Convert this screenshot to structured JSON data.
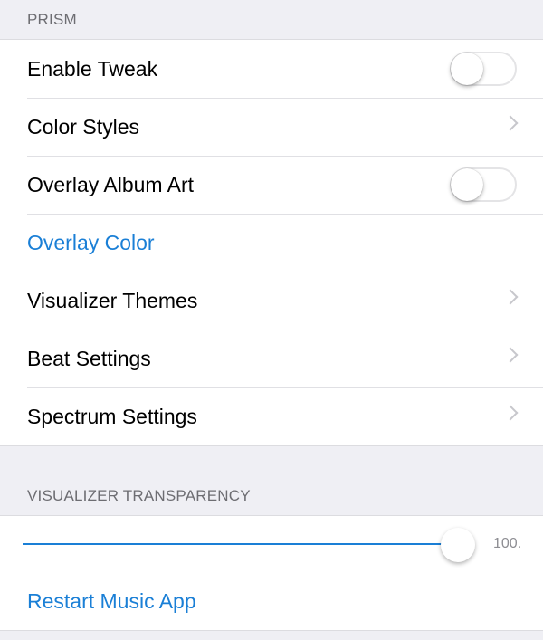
{
  "sections": [
    {
      "header": "PRISM",
      "rows": [
        {
          "label": "Enable Tweak",
          "accessory": "toggle",
          "on": false
        },
        {
          "label": "Color Styles",
          "accessory": "chevron"
        },
        {
          "label": "Overlay Album Art",
          "accessory": "toggle",
          "on": false
        },
        {
          "label": "Overlay Color",
          "accessory": "none",
          "style": "link"
        },
        {
          "label": "Visualizer Themes",
          "accessory": "chevron"
        },
        {
          "label": "Beat Settings",
          "accessory": "chevron"
        },
        {
          "label": "Spectrum Settings",
          "accessory": "chevron"
        }
      ]
    },
    {
      "header": "VISUALIZER TRANSPARENCY",
      "slider": {
        "value": 100,
        "min": 0,
        "max": 100,
        "value_label": "100."
      },
      "action": {
        "label": "Restart Music App"
      }
    }
  ],
  "colors": {
    "accent": "#1a7fd6",
    "background": "#efeff4"
  }
}
